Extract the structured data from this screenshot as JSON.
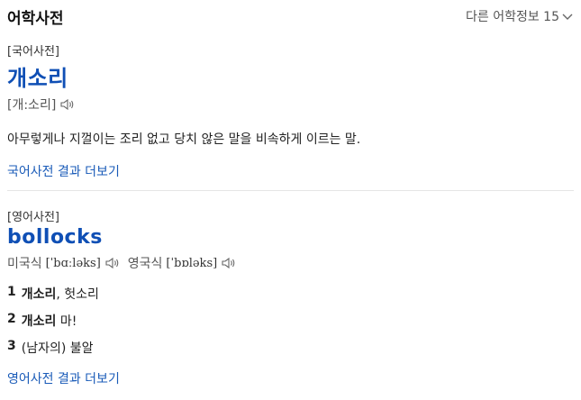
{
  "header": {
    "title": "어학사전",
    "more_label": "다른 어학정보 15"
  },
  "korean": {
    "dict_label": "[국어사전]",
    "headword": "개소리",
    "pronunciation": "[개:소리]",
    "definition": "아무렇게나 지껄이는 조리 없고 당치 않은 말을 비속하게 이르는 말.",
    "more_link": "국어사전 결과 더보기"
  },
  "english": {
    "dict_label": "[영어사전]",
    "headword": "bollocks",
    "us_label": "미국식",
    "us_ipa": "[ˈbɑːləks]",
    "uk_label": "영국식",
    "uk_ipa": "[ˈbɒləks]",
    "meanings": [
      {
        "num": "1",
        "bold": "개소리",
        "rest": ", 헛소리"
      },
      {
        "num": "2",
        "bold": "개소리",
        "rest": " 마!"
      },
      {
        "num": "3",
        "bold": "",
        "rest": "(남자의) 불알"
      }
    ],
    "more_link": "영어사전 결과 더보기"
  },
  "colors": {
    "headword": "#0f4fb5",
    "link": "#1a5bb8"
  },
  "icons": [
    "chevron-down-icon",
    "speaker-icon"
  ]
}
